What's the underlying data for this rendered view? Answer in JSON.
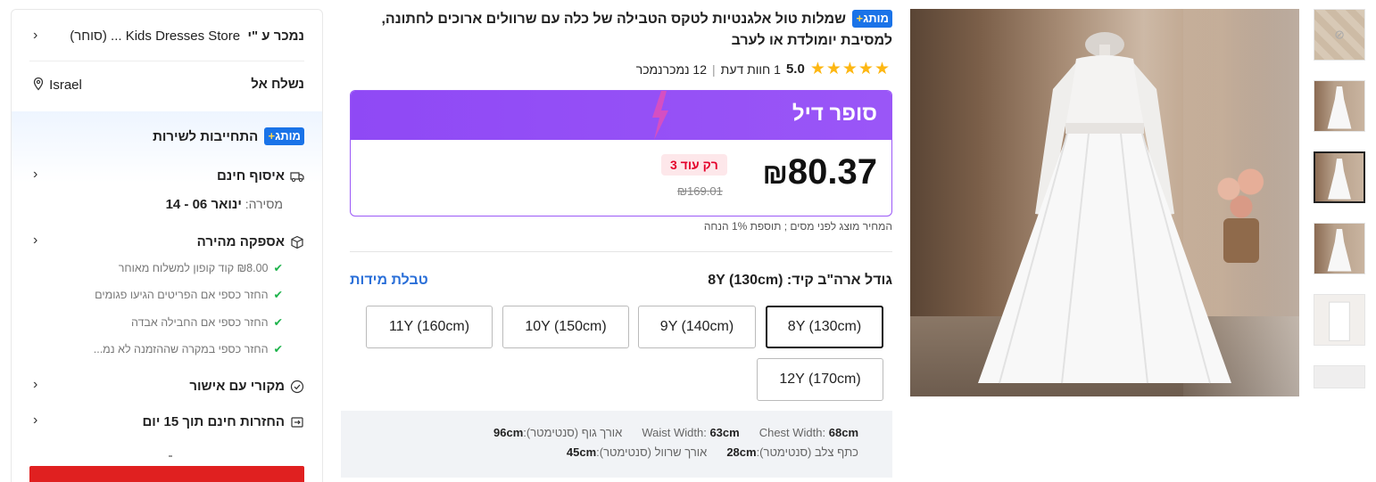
{
  "thumbnails": [
    "thumb-no-image",
    "thumb-dress-room",
    "thumb-dress-room-selected",
    "thumb-dress-flowers",
    "thumb-lace-detail",
    "thumb-partial"
  ],
  "product": {
    "choice_badge": "מותג",
    "title": "שמלות טול אלגנטיות לטקס הטבילה של כלה עם שרוולים ארוכים לחתונה, למסיבת יומולדת או לערב",
    "rating_score": "5.0",
    "review_count": "1",
    "review_label": "חוות דעת",
    "sold_count": "12",
    "sold_label": "נמכרנמכר",
    "stars": "★★★★★"
  },
  "deal": {
    "label": "סופר דיל",
    "price": "80.37",
    "currency": "₪",
    "left_badge": "רק עוד 3",
    "old_price": "₪169.01",
    "tax_note": "המחיר מוצג לפני מסים ; תוספת 1% הנחה"
  },
  "size": {
    "label": "גודל ארה\"ב קיד:",
    "selected": "8Y (130cm)",
    "chart_link": "טבלת מידות",
    "options": [
      "8Y (130cm)",
      "9Y (140cm)",
      "10Y (150cm)",
      "11Y (160cm)",
      "12Y (170cm)"
    ]
  },
  "measurements": {
    "chest_label": "Chest Width:",
    "chest_value": "68cm",
    "waist_label": "Waist Width:",
    "waist_value": "63cm",
    "body_length_label": "אורך גוף (סנטימטר):",
    "body_length_value": "96cm",
    "shoulder_label": "כתף צלב (סנטימטר):",
    "shoulder_value": "28cm",
    "sleeve_label": "אורך שרוול (סנטימטר):",
    "sleeve_value": "45cm"
  },
  "sidebar": {
    "sold_by_label": "נמכר ע \"י",
    "store_name": "Kids Dresses Store ...",
    "store_suffix": "(סוחר)",
    "ship_to_label": "נשלח אל",
    "country": "Israel",
    "choice_badge": "מותג",
    "commitment": "התחייבות לשירות",
    "free_pickup": "איסוף חינם",
    "delivery_label": "מסירה:",
    "delivery_date": "ינואר 06 - 14",
    "fast_delivery": "אספקה מהירה",
    "bullets": [
      "₪8.00 קוד קופון למשלוח מאוחר",
      "החזר כספי אם הפריטים הגיעו פגומים",
      "החזר כספי אם החבילה אבדה",
      "החזר כספי במקרה שההזמנה לא נמ..."
    ],
    "authentic": "מקורי עם אישור",
    "free_returns": "החזרות חינם תוך 15 יום"
  },
  "colors": {
    "accent_blue": "#1a73e8",
    "deal_purple": "#9a56f7",
    "price_red": "#e4002b",
    "star_yellow": "#fdb713",
    "check_green": "#1db34b"
  }
}
